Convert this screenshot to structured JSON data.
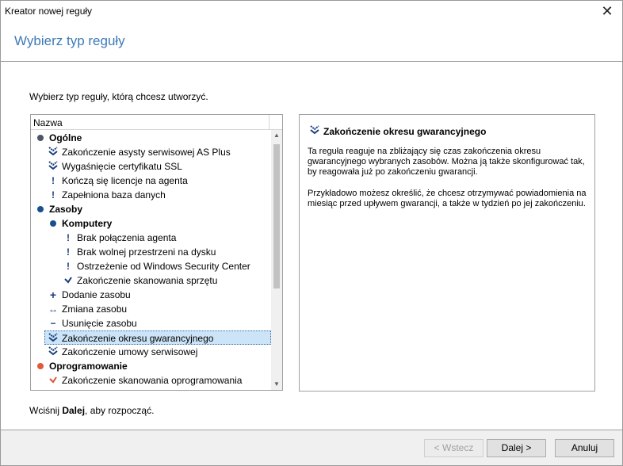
{
  "window": {
    "title": "Kreator nowej reguły",
    "close_label": "✕"
  },
  "header": {
    "heading": "Wybierz typ reguły"
  },
  "prompt": "Wybierz typ reguły, którą chcesz utworzyć.",
  "tree": {
    "column_header": "Nazwa",
    "rows": [
      {
        "label": "Ogólne",
        "icon": "gray-dot-icon",
        "level": 0,
        "bold": true
      },
      {
        "label": "Zakończenie asysty serwisowej AS Plus",
        "icon": "double-chevron-icon",
        "level": 1
      },
      {
        "label": "Wygaśnięcie certyfikatu SSL",
        "icon": "double-chevron-icon",
        "level": 1
      },
      {
        "label": "Kończą się licencje na agenta",
        "icon": "exclamation-icon",
        "level": 1
      },
      {
        "label": "Zapełniona baza danych",
        "icon": "exclamation-icon",
        "level": 1
      },
      {
        "label": "Zasoby",
        "icon": "blue-dot-icon",
        "level": 0,
        "bold": true
      },
      {
        "label": "Komputery",
        "icon": "blue-dot-icon",
        "level": 1,
        "bold": true
      },
      {
        "label": "Brak połączenia agenta",
        "icon": "exclamation-icon",
        "level": 2
      },
      {
        "label": "Brak wolnej przestrzeni na dysku",
        "icon": "exclamation-icon",
        "level": 2
      },
      {
        "label": "Ostrzeżenie od Windows Security Center",
        "icon": "exclamation-icon",
        "level": 2
      },
      {
        "label": "Zakończenie skanowania sprzętu",
        "icon": "check-icon",
        "level": 2
      },
      {
        "label": "Dodanie zasobu",
        "icon": "plus-icon",
        "level": 1
      },
      {
        "label": "Zmiana zasobu",
        "icon": "double-arrow-icon",
        "level": 1
      },
      {
        "label": "Usunięcie zasobu",
        "icon": "minus-icon",
        "level": 1
      },
      {
        "label": "Zakończenie okresu gwarancyjnego",
        "icon": "double-chevron-icon",
        "level": 1,
        "selected": true
      },
      {
        "label": "Zakończenie umowy serwisowej",
        "icon": "double-chevron-icon",
        "level": 1
      },
      {
        "label": "Oprogramowanie",
        "icon": "orange-dot-icon",
        "level": 0,
        "bold": true
      },
      {
        "label": "Zakończenie skanowania oprogramowania",
        "icon": "red-check-icon",
        "level": 1
      }
    ]
  },
  "details": {
    "title": "Zakończenie okresu gwarancyjnego",
    "description": "Ta reguła reaguje na zbliżający się czas zakończenia okresu gwarancyjnego wybranych zasobów. Można ją także skonfigurować tak, by reagowała już po zakończeniu gwarancji.",
    "example": "Przykładowo możesz określić, że chcesz otrzymywać powiadomienia na miesiąc przed upływem gwarancji, a także w tydzień po jej zakończeniu."
  },
  "footer": {
    "hint_before": "Wciśnij ",
    "hint_bold": "Dalej",
    "hint_after": ", aby rozpocząć."
  },
  "buttons": {
    "back": "< Wstecz",
    "next": "Dalej >",
    "cancel": "Anuluj"
  }
}
